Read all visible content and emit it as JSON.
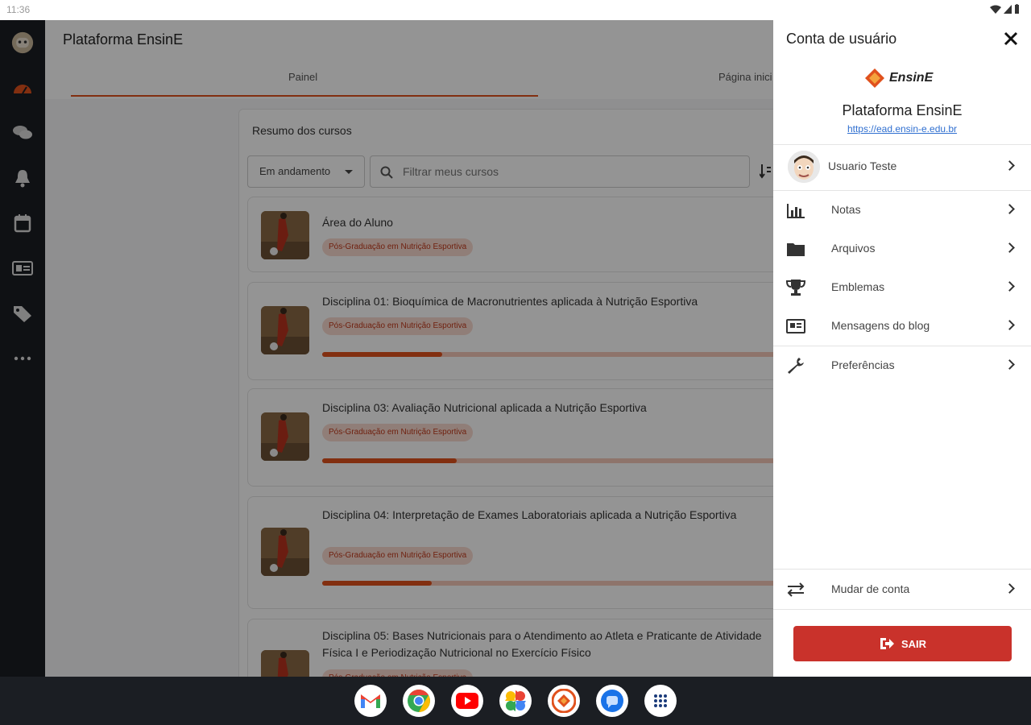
{
  "status_bar": {
    "time": "11:36"
  },
  "rail": {
    "items": [
      {
        "icon": "avatar-icon"
      },
      {
        "icon": "dashboard-icon",
        "active": true
      },
      {
        "icon": "chat-icon"
      },
      {
        "icon": "bell-icon"
      },
      {
        "icon": "calendar-icon"
      },
      {
        "icon": "id-card-icon"
      },
      {
        "icon": "tag-icon"
      },
      {
        "icon": "more-icon"
      }
    ]
  },
  "main": {
    "title": "Plataforma EnsinE",
    "tabs": [
      {
        "label": "Painel",
        "active": true
      },
      {
        "label": "Página inici"
      }
    ],
    "section_title": "Resumo dos cursos",
    "filter": {
      "selected": "Em andamento"
    },
    "search": {
      "placeholder": "Filtrar meus cursos"
    },
    "courses": [
      {
        "title": "Área do Aluno",
        "category": "Pós-Graduação em Nutrição Esportiva"
      },
      {
        "title": "Disciplina 01: Bioquímica de Macronutrientes aplicada à Nutrição Esportiva",
        "category": "Pós-Graduação em Nutrição Esportiva",
        "progress": 0.24
      },
      {
        "title": "Disciplina 03: Avaliação Nutricional aplicada a Nutrição Esportiva",
        "category": "Pós-Graduação em Nutrição Esportiva",
        "progress": 0.27
      },
      {
        "title": "Disciplina 04: Interpretação de Exames Laboratoriais aplicada a Nutrição Esportiva",
        "category": "Pós-Graduação em Nutrição Esportiva",
        "progress": 0.22
      },
      {
        "title": "Disciplina 05: Bases Nutricionais para o Atendimento ao Atleta e Praticante de Atividade Física I e Periodização Nutricional no Exercício Físico",
        "category": "Pós-Graduação em Nutrição Esportiva"
      }
    ]
  },
  "drawer": {
    "title": "Conta de usuário",
    "logo_text": "EnsinE",
    "site_name": "Plataforma EnsinE",
    "site_url": "https://ead.ensin-e.edu.br",
    "user_name": "Usuario Teste",
    "menu": [
      {
        "label": "Notas",
        "icon": "grades-icon"
      },
      {
        "label": "Arquivos",
        "icon": "folder-icon"
      },
      {
        "label": "Emblemas",
        "icon": "trophy-icon"
      },
      {
        "label": "Mensagens do blog",
        "icon": "blog-icon"
      },
      {
        "label": "Preferências",
        "icon": "wrench-icon"
      }
    ],
    "switch_account": "Mudar de conta",
    "logout": "SAIR"
  },
  "taskbar": {
    "apps": [
      "gmail-icon",
      "chrome-icon",
      "youtube-icon",
      "photos-icon",
      "ensine-app-icon",
      "messages-icon",
      "launcher-icon"
    ]
  },
  "colors": {
    "accent": "#e0511d",
    "logout": "#c9322b",
    "rail": "#1b1e23"
  }
}
